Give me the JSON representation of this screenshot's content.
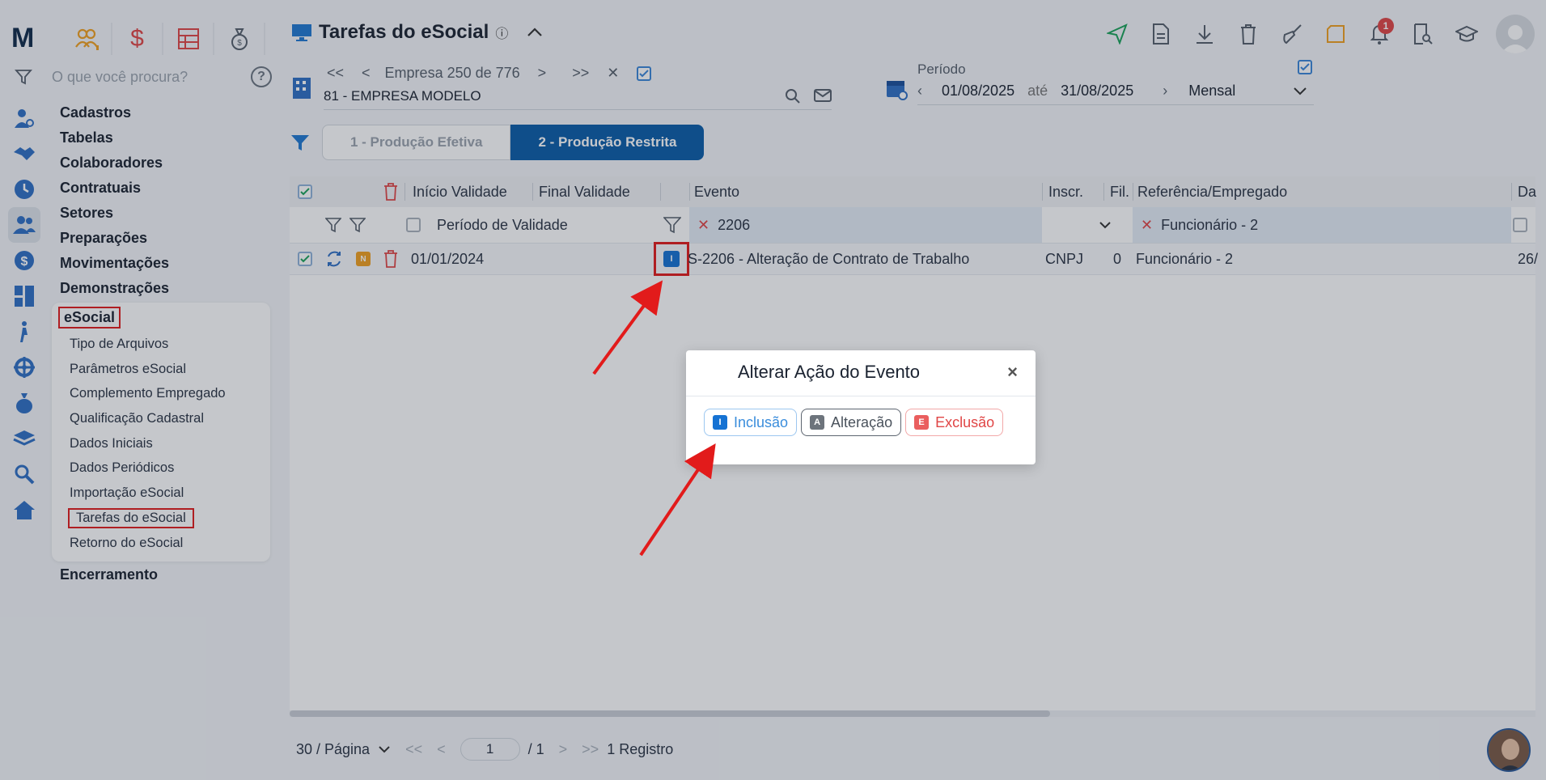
{
  "app": {
    "logo": "M",
    "search_placeholder": "O que você procura?",
    "help": "?"
  },
  "top_apps": [
    {
      "icon": "people-group-icon",
      "color": "#f0a020"
    },
    {
      "icon": "dollar-icon",
      "color": "#e04646"
    },
    {
      "icon": "spreadsheet-icon",
      "color": "#e04646"
    },
    {
      "icon": "money-bag-icon",
      "color": "#555f6b"
    }
  ],
  "rail": [
    "user-gear-icon",
    "handshake-icon",
    "clock-icon",
    "users-icon",
    "dollar-circle-icon",
    "calculator-icon",
    "person-walk-icon",
    "settings-network-icon",
    "money-bag-icon",
    "layers-icon",
    "magnifier-icon",
    "home-icon"
  ],
  "menu": {
    "items": [
      "Cadastros",
      "Tabelas",
      "Colaboradores",
      "Contratuais",
      "Setores",
      "Preparações",
      "Movimentações",
      "Demonstrações"
    ],
    "esocial": {
      "title": "eSocial",
      "subitems": [
        "Tipo de Arquivos",
        "Parâmetros eSocial",
        "Complemento Empregado",
        "Qualificação Cadastral",
        "Dados Iniciais",
        "Dados Periódicos",
        "Importação eSocial",
        "Tarefas do eSocial",
        "Retorno do eSocial"
      ]
    },
    "last": "Encerramento"
  },
  "header": {
    "title": "Tarefas do eSocial",
    "info": "ⓘ",
    "notification_count": "1"
  },
  "company": {
    "nav_first": "<<",
    "nav_prev": "<",
    "label": "Empresa 250 de 776",
    "nav_next": ">",
    "nav_last": ">>",
    "clear": "✕",
    "name": "81 - EMPRESA MODELO"
  },
  "period": {
    "label": "Período",
    "start": "01/08/2025",
    "until": "até",
    "end": "31/08/2025",
    "mode": "Mensal"
  },
  "tabs": [
    {
      "label": "1 - Produção Efetiva",
      "active": false
    },
    {
      "label": "2 - Produção Restrita",
      "active": true
    }
  ],
  "grid": {
    "headers": {
      "inicio": "Início Validade",
      "final": "Final Validade",
      "evento": "Evento",
      "inscr": "Inscr.",
      "fil": "Fil.",
      "ref": "Referência/Empregado",
      "da": "Da"
    },
    "filters": {
      "periodo": "Período de Validade",
      "evento": "2206",
      "ref": "Funcionário - 2"
    },
    "row": {
      "n_badge": "N",
      "i_badge": "I",
      "inicio": "01/01/2024",
      "evento": "S-2206 - Alteração de Contrato de Trabalho",
      "inscr": "CNPJ",
      "fil": "0",
      "ref": "Funcionário - 2",
      "da": "26/"
    }
  },
  "pager": {
    "page_size": "30 / Página",
    "first": "<<",
    "prev": "<",
    "page": "1",
    "total": "/ 1",
    "next": ">",
    "last": ">>",
    "records": "1 Registro"
  },
  "modal": {
    "title": "Alterar Ação do Evento",
    "close": "×",
    "buttons": [
      {
        "letter": "I",
        "label": "Inclusão"
      },
      {
        "letter": "A",
        "label": "Alteração"
      },
      {
        "letter": "E",
        "label": "Exclusão"
      }
    ]
  },
  "colors": {
    "primary": "#0a5ca8",
    "highlight": "#e21b1b",
    "inclusao": "#1572d3",
    "exclusao": "#e04646"
  }
}
